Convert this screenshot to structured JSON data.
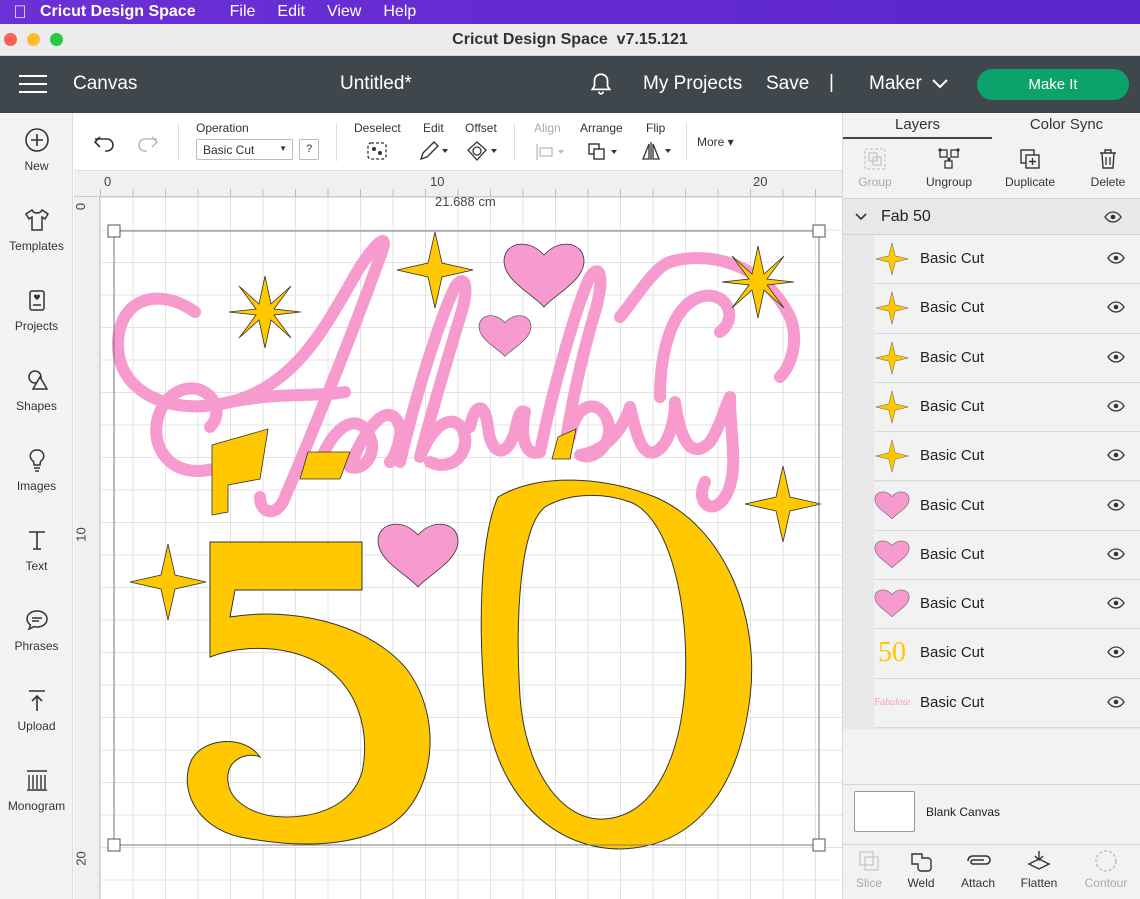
{
  "macmenu": {
    "app": "Cricut Design Space",
    "items": [
      "File",
      "Edit",
      "View",
      "Help"
    ]
  },
  "window": {
    "title": "Cricut Design Space  v7.15.121"
  },
  "header": {
    "section": "Canvas",
    "doc_title": "Untitled*",
    "my_projects": "My Projects",
    "save": "Save",
    "separator": "|",
    "machine": "Maker",
    "make_it": "Make It"
  },
  "sidebar": {
    "items": [
      {
        "label": "New",
        "icon": "plus-circle-icon"
      },
      {
        "label": "Templates",
        "icon": "shirt-icon"
      },
      {
        "label": "Projects",
        "icon": "projects-icon"
      },
      {
        "label": "Shapes",
        "icon": "shapes-icon"
      },
      {
        "label": "Images",
        "icon": "lightbulb-icon"
      },
      {
        "label": "Text",
        "icon": "text-icon"
      },
      {
        "label": "Phrases",
        "icon": "speech-bubble-icon"
      },
      {
        "label": "Upload",
        "icon": "upload-icon"
      },
      {
        "label": "Monogram",
        "icon": "monogram-icon"
      }
    ]
  },
  "toolbar": {
    "operation_label": "Operation",
    "operation_value": "Basic Cut",
    "help": "?",
    "deselect": "Deselect",
    "edit": "Edit",
    "offset": "Offset",
    "align": "Align",
    "arrange": "Arrange",
    "flip": "Flip",
    "more": "More"
  },
  "rulers": {
    "top": [
      "0",
      "10",
      "20"
    ],
    "left": [
      "0",
      "10",
      "20"
    ]
  },
  "canvas": {
    "width_readout": "21.688 cm",
    "design": {
      "word": "Fabulous",
      "number": "50",
      "pink": "#f79acd",
      "yellow": "#ffc800"
    }
  },
  "panel": {
    "tabs": [
      "Layers",
      "Color Sync"
    ],
    "actions": [
      "Group",
      "Ungroup",
      "Duplicate",
      "Delete"
    ],
    "group_name": "Fab 50",
    "layers": [
      {
        "name": "Basic Cut",
        "thumb": "star"
      },
      {
        "name": "Basic Cut",
        "thumb": "star"
      },
      {
        "name": "Basic Cut",
        "thumb": "star"
      },
      {
        "name": "Basic Cut",
        "thumb": "star"
      },
      {
        "name": "Basic Cut",
        "thumb": "star"
      },
      {
        "name": "Basic Cut",
        "thumb": "heart"
      },
      {
        "name": "Basic Cut",
        "thumb": "heart"
      },
      {
        "name": "Basic Cut",
        "thumb": "heart"
      },
      {
        "name": "Basic Cut",
        "thumb": "fifty",
        "thumb_text": "50"
      },
      {
        "name": "Basic Cut",
        "thumb": "fabulous",
        "thumb_text": "Fabulous"
      }
    ],
    "blank_canvas": "Blank Canvas",
    "bottom_actions": [
      "Slice",
      "Weld",
      "Attach",
      "Flatten",
      "Contour"
    ]
  }
}
